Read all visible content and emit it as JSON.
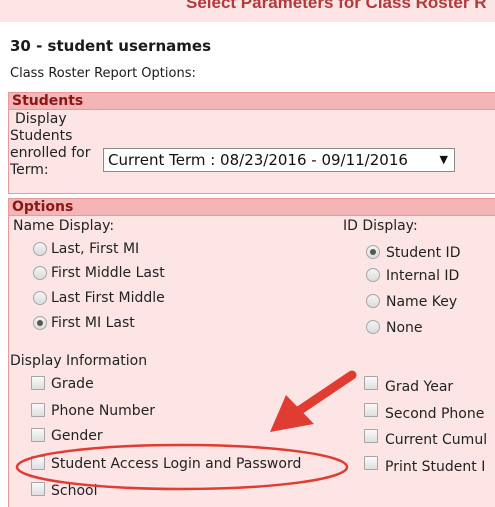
{
  "header": {
    "page_title": "Select Parameters for Class Roster R",
    "report_title": "30 -  student usernames",
    "options_label": "Class Roster Report Options:"
  },
  "students": {
    "section_title": "Students",
    "display_line1": "Display",
    "display_line2": "Students",
    "display_line3": "enrolled for",
    "display_line4": "Term:",
    "term_value": "Current Term : 08/23/2016 - 09/11/2016"
  },
  "options": {
    "section_title": "Options",
    "name_display_label": "Name Display:",
    "name_options": [
      {
        "label": "Last, First MI",
        "selected": false
      },
      {
        "label": "First Middle Last",
        "selected": false
      },
      {
        "label": "Last First Middle",
        "selected": false
      },
      {
        "label": "First MI Last",
        "selected": true
      }
    ],
    "id_display_label": "ID Display:",
    "id_options": [
      {
        "label": "Student ID",
        "selected": true
      },
      {
        "label": "Internal ID",
        "selected": false
      },
      {
        "label": "Name Key",
        "selected": false
      },
      {
        "label": "None",
        "selected": false
      }
    ],
    "display_info_label": "Display Information",
    "left_checks": [
      {
        "label": "Grade",
        "checked": false
      },
      {
        "label": "Phone Number",
        "checked": false
      },
      {
        "label": "Gender",
        "checked": false
      },
      {
        "label": "Student Access Login and Password",
        "checked": false
      },
      {
        "label": "School",
        "checked": false
      }
    ],
    "right_checks": [
      {
        "label": "Grad Year",
        "checked": false
      },
      {
        "label": "Second Phone",
        "checked": false
      },
      {
        "label": "Current Cumul",
        "checked": false
      },
      {
        "label": "Print Student I",
        "checked": false
      }
    ]
  },
  "colors": {
    "panel_bg": "#fde5e5",
    "header_bg": "#f3b5b5",
    "header_text": "#8c1616",
    "annotation": "#e03c31"
  }
}
